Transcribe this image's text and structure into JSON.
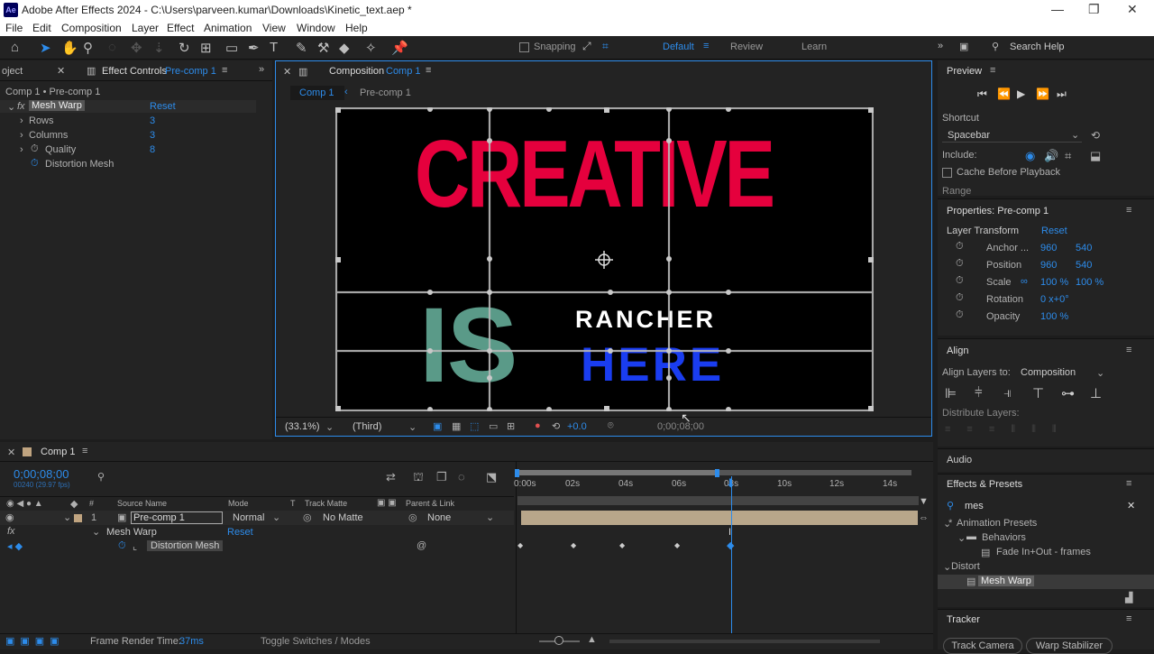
{
  "window": {
    "title": "Adobe After Effects 2024 - C:\\Users\\parveen.kumar\\Downloads\\Kinetic_text.aep *",
    "logo": "Ae",
    "minimize": "—",
    "maximize": "❐",
    "close": "✕"
  },
  "menu": [
    "File",
    "Edit",
    "Composition",
    "Layer",
    "Effect",
    "Animation",
    "View",
    "Window",
    "Help"
  ],
  "toolbar": {
    "snapping": "Snapping",
    "workspaces": [
      "Default",
      "Review",
      "Learn"
    ],
    "search": "Search Help"
  },
  "effect_controls": {
    "tab_prefix": "oject",
    "tab_title": "Effect Controls",
    "tab_target": "Pre-comp 1",
    "header": "Comp 1 • Pre-comp 1",
    "effect_name": "Mesh Warp",
    "reset": "Reset",
    "props": [
      {
        "name": "Rows",
        "value": "3"
      },
      {
        "name": "Columns",
        "value": "3"
      },
      {
        "name": "Quality",
        "value": "8"
      },
      {
        "name": "Distortion Mesh",
        "value": ""
      }
    ]
  },
  "composition": {
    "tab_title": "Composition",
    "tab_target": "Comp 1",
    "crumbs": [
      "Comp 1",
      "Pre-comp 1"
    ],
    "text_line1": "CREATIVE",
    "text_is": "IS",
    "text_rancher": "RANCHER",
    "text_here": "HERE",
    "zoom": "(33.1%)",
    "resolution": "(Third)",
    "exposure": "+0.0",
    "timecode": "0;00;08;00",
    "colors": {
      "creative": "#e5003d",
      "is": "#5a9a88",
      "rancher": "#ffffff",
      "here": "#1a3df0"
    }
  },
  "preview": {
    "title": "Preview",
    "shortcut_label": "Shortcut",
    "shortcut_value": "Spacebar",
    "include_label": "Include:",
    "cache_label": "Cache Before Playback",
    "range_label": "Range"
  },
  "properties": {
    "title": "Properties: Pre-comp 1",
    "section": "Layer Transform",
    "reset": "Reset",
    "rows": [
      {
        "name": "Anchor ...",
        "v1": "960",
        "v2": "540"
      },
      {
        "name": "Position",
        "v1": "960",
        "v2": "540"
      },
      {
        "name": "Scale",
        "v1": "100 %",
        "v2": "100 %"
      },
      {
        "name": "Rotation",
        "v1": "0 x+0°",
        "v2": ""
      },
      {
        "name": "Opacity",
        "v1": "100 %",
        "v2": ""
      }
    ]
  },
  "align": {
    "title": "Align",
    "align_to_label": "Align Layers to:",
    "align_to_value": "Composition",
    "distribute": "Distribute Layers:"
  },
  "audio": {
    "title": "Audio"
  },
  "effects_presets": {
    "title": "Effects & Presets",
    "search": "mes",
    "tree": [
      {
        "label": "Animation Presets",
        "indent": 0
      },
      {
        "label": "Behaviors",
        "indent": 1
      },
      {
        "label": "Fade In+Out - frames",
        "indent": 2
      },
      {
        "label": "Distort",
        "indent": 0
      },
      {
        "label": "Mesh Warp",
        "indent": 1
      }
    ]
  },
  "tracker": {
    "title": "Tracker",
    "buttons": [
      "Track Camera",
      "Warp Stabilizer"
    ]
  },
  "timeline": {
    "tab": "Comp 1",
    "timecode": "0;00;08;00",
    "fps": "00240 (29.97 fps)",
    "headers": [
      "Source Name",
      "Mode",
      "T",
      "Track Matte",
      "Parent & Link"
    ],
    "layer": {
      "num": "1",
      "name": "Pre-comp 1",
      "mode": "Normal",
      "matte": "No Matte",
      "parent": "None"
    },
    "effect_row": {
      "name": "Mesh Warp",
      "reset": "Reset"
    },
    "prop_row": {
      "name": "Distortion Mesh"
    },
    "ruler": [
      "0:00s",
      "02s",
      "04s",
      "06s",
      "08s",
      "10s",
      "12s",
      "14s"
    ],
    "footer_render": "Frame Render Time:",
    "footer_ms": "37ms",
    "footer_toggle": "Toggle Switches / Modes"
  }
}
